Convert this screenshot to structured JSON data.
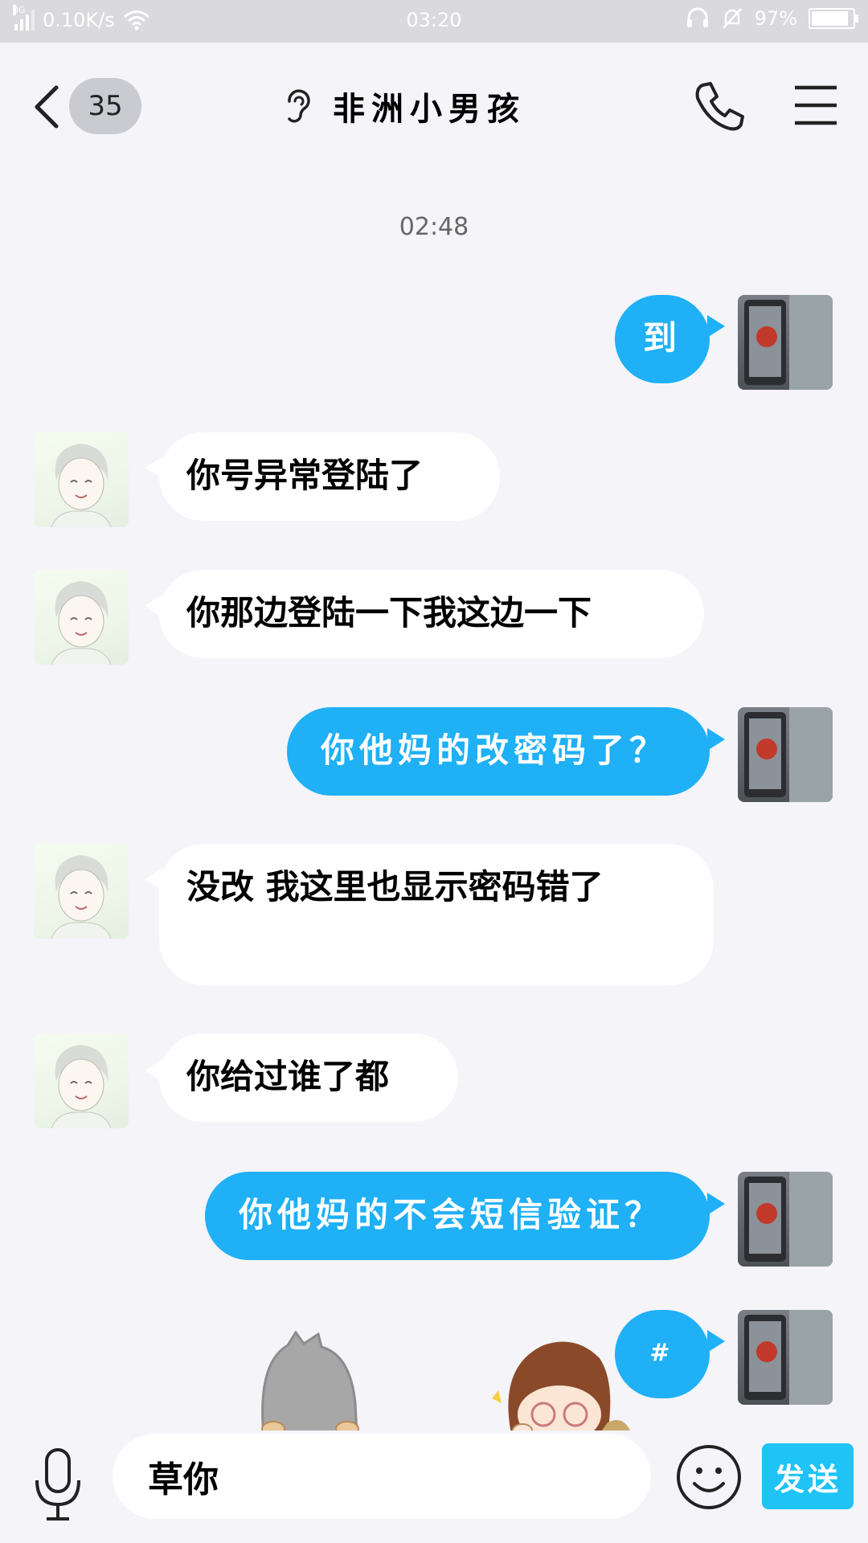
{
  "status_bar": {
    "network_type": "3G",
    "speed": "0.10K/s",
    "time": "03:20",
    "battery": "97%",
    "battery_level": 0.97
  },
  "header": {
    "unread_count": "35",
    "title": "非洲小男孩"
  },
  "timestamp": "02:48",
  "messages": [
    {
      "side": "out",
      "text": "到"
    },
    {
      "side": "in",
      "text": "你号异常登陆了"
    },
    {
      "side": "in",
      "text": "你那边登陆一下我这边一下"
    },
    {
      "side": "out",
      "text": "你他妈的改密码了？"
    },
    {
      "side": "in",
      "text": "没改 我这里也显示密码错了"
    },
    {
      "side": "in",
      "text": "你给过谁了都"
    },
    {
      "side": "out",
      "text": "你他妈的不会短信验证？"
    },
    {
      "side": "out",
      "text": "#"
    }
  ],
  "input": {
    "value": "草你",
    "send_label": "发送"
  },
  "colors": {
    "outgoing_bubble": "#1fb0f6",
    "incoming_bubble": "#ffffff",
    "send_button": "#1fc3f5",
    "background": "#f4f4f9"
  }
}
